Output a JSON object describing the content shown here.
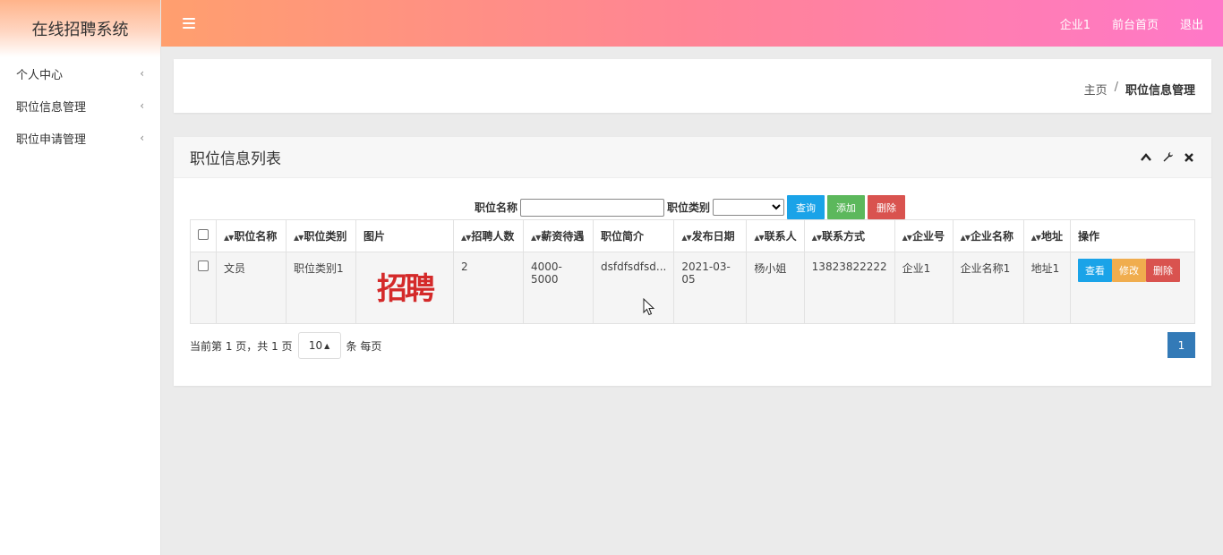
{
  "app": {
    "title": "在线招聘系统"
  },
  "sidebar": {
    "items": [
      {
        "label": "个人中心"
      },
      {
        "label": "职位信息管理"
      },
      {
        "label": "职位申请管理"
      }
    ]
  },
  "topbar": {
    "links": [
      {
        "label": "企业1"
      },
      {
        "label": "前台首页"
      },
      {
        "label": "退出"
      }
    ]
  },
  "breadcrumb": {
    "home": "主页",
    "separator": "/",
    "current": "职位信息管理"
  },
  "panel": {
    "title": "职位信息列表"
  },
  "search": {
    "name_label": "职位名称",
    "name_value": "",
    "category_label": "职位类别",
    "category_selected": "",
    "query_label": "查询",
    "add_label": "添加",
    "delete_label": "删除"
  },
  "table": {
    "headers": {
      "name": "职位名称",
      "category": "职位类别",
      "image": "图片",
      "count": "招聘人数",
      "salary": "薪资待遇",
      "intro": "职位简介",
      "date": "发布日期",
      "contact": "联系人",
      "phone": "联系方式",
      "company_no": "企业号",
      "company_name": "企业名称",
      "address": "地址",
      "actions": "操作"
    },
    "rows": [
      {
        "name": "文员",
        "category": "职位类别1",
        "image_text": "招聘",
        "count": "2",
        "salary": "4000-5000",
        "intro": "dsfdfsdfsd...",
        "date": "2021-03-05",
        "contact": "杨小姐",
        "phone": "13823822222",
        "company_no": "企业1",
        "company_name": "企业名称1",
        "address": "地址1",
        "view_label": "查看",
        "edit_label": "修改",
        "delete_label": "删除"
      }
    ]
  },
  "pagination": {
    "info": "当前第 1 页，共 1 页",
    "page_size": "10",
    "per_page_suffix": "条 每页",
    "current_page": "1"
  },
  "colors": {
    "primary": "#337ab7",
    "info": "#1aa3e8",
    "success": "#5cb85c",
    "danger": "#d9534f",
    "warning": "#f0ad4e"
  }
}
